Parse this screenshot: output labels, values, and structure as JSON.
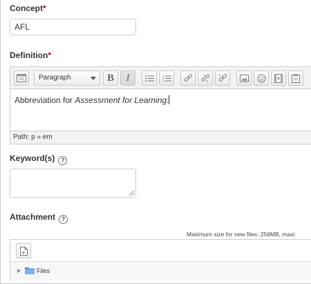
{
  "concept": {
    "label": "Concept",
    "required": "*",
    "value": "AFL"
  },
  "definition": {
    "label": "Definition",
    "required": "*",
    "toolbar": {
      "format_select": "Paragraph",
      "bold": "B",
      "italic": "I"
    },
    "content": {
      "text_plain": "Abbreviation for ",
      "text_italic": "Assessment for Learning."
    },
    "path": "Path: p » em"
  },
  "keywords": {
    "label": "Keyword(s)",
    "help": "?",
    "value": ""
  },
  "attachment": {
    "label": "Attachment",
    "help": "?",
    "max_size": "Maximum size for new files: 256MB, maxi",
    "tree_folder": "Files"
  },
  "colors": {
    "required": "#cc0000",
    "folder": "#5a8fd6",
    "toolbar_bg": "#f3f3f3"
  }
}
